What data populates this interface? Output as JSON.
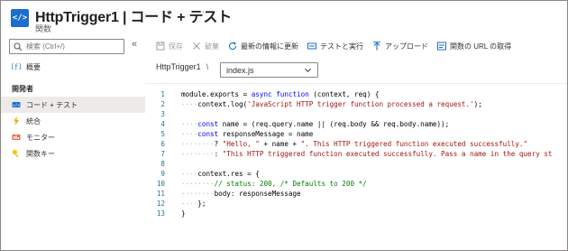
{
  "header": {
    "title": "HttpTrigger1 | コード + テスト",
    "subtitle": "関数",
    "more": "···",
    "icon_text": "</>"
  },
  "sidebar": {
    "search": {
      "placeholder": "検索 (Ctrl+/)"
    },
    "collapse": "«",
    "overview": {
      "label": "概要"
    },
    "section": "開発者",
    "items": [
      {
        "label": "コード + テスト",
        "icon": "code-icon",
        "active": true
      },
      {
        "label": "統合",
        "icon": "lightning-icon"
      },
      {
        "label": "モニター",
        "icon": "monitor-icon"
      },
      {
        "label": "関数キー",
        "icon": "key-icon"
      }
    ]
  },
  "toolbar": {
    "save": "保存",
    "discard": "破棄",
    "refresh": "最新の情報に更新",
    "test": "テストと実行",
    "upload": "アップロード",
    "get_url": "関数の URL の取得"
  },
  "breadcrumb": {
    "function": "HttpTrigger1",
    "separator": "\\",
    "file": "index.js"
  },
  "colors": {
    "accent": "#1c6dd0",
    "keyword": "#0000ff",
    "string": "#a31515",
    "comment": "#008000",
    "line_number": "#237893"
  },
  "code": {
    "line_numbers": [
      "1",
      "2",
      "3",
      "4",
      "5",
      "6",
      "7",
      "8",
      "9",
      "10",
      "11",
      "12",
      "13"
    ]
  }
}
